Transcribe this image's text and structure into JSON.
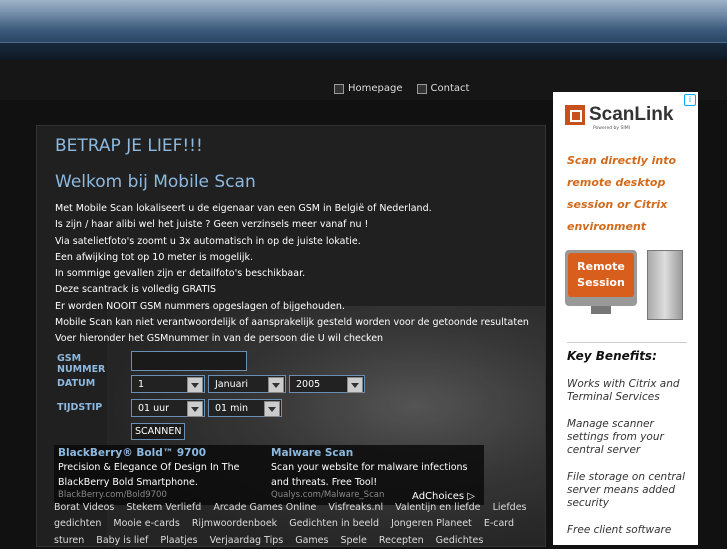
{
  "nav": {
    "home": "Homepage",
    "contact": "Contact"
  },
  "main": {
    "title": "BETRAP JE LIEF!!!",
    "subtitle": "Welkom bij Mobile Scan",
    "lines": [
      "Met Mobile Scan lokaliseert u de eigenaar van een GSM in België of Nederland.",
      "Is zijn / haar alibi wel het juiste ? Geen verzinsels meer vanaf nu !",
      "Via satelietfoto's zoomt u 3x automatisch in op de juiste lokatie.",
      "Een afwijking tot op 10 meter is mogelijk.",
      "In sommige gevallen zijn er detailfoto's beschikbaar.",
      "Deze scantrack is volledig GRATIS",
      "Er worden NOOIT GSM nummers opgeslagen of bijgehouden.",
      "Mobile Scan kan niet verantwoordelijk of aansprakelijk gesteld worden voor de getoonde resultaten",
      "Voer hieronder het GSMnummer in van de persoon die U wil checken"
    ]
  },
  "form": {
    "gsm_label": "GSM NUMMER",
    "gsm_value": "",
    "datum_label": "DATUM",
    "day": "1",
    "month": "Januari",
    "year": "2005",
    "tijd_label": "TIJDSTIP",
    "hour": "01 uur",
    "minute": "01 min",
    "submit": "SCANNEN"
  },
  "ads": [
    {
      "title": "BlackBerry® Bold™ 9700",
      "desc": "Precision & Elegance Of Design In The BlackBerry Bold Smartphone.",
      "url": "BlackBerry.com/Bold9700"
    },
    {
      "title": "Malware Scan",
      "desc": "Scan your website for malware infections and threats. Free Tool!",
      "url": "Qualys.com/Malware_Scan"
    }
  ],
  "adchoices": "AdChoices ▷",
  "links": [
    "Borat Videos",
    "Stekem Verliefd",
    "Arcade Games Online",
    "Visfreaks.nl",
    "Valentijn en liefde",
    "Liefdes gedichten",
    "Mooie e-cards",
    "Rijmwoordenboek",
    "Gedichten in beeld",
    "Jongeren Planeet",
    "E-card sturen",
    "Baby is lief",
    "Plaatjes",
    "Verjaardag Tips",
    "Games",
    "Spele",
    "Recepten",
    "Gedichtes"
  ],
  "sidebar": {
    "brand": "ScanLink",
    "brand_sub": "Powered by SIMI",
    "tagline": [
      "Scan directly into",
      "remote desktop",
      "session or Citrix",
      "environment"
    ],
    "remote": "Remote Session",
    "key_benefits": "Key Benefits:",
    "benefits": [
      "Works with Citrix and Terminal Services",
      "Manage scanner settings from your central server",
      "File storage on central server means added security",
      "Free client software"
    ]
  },
  "colors": {
    "heading_blue": "#8db9e0",
    "sidebar_orange": "#d26a1c"
  }
}
